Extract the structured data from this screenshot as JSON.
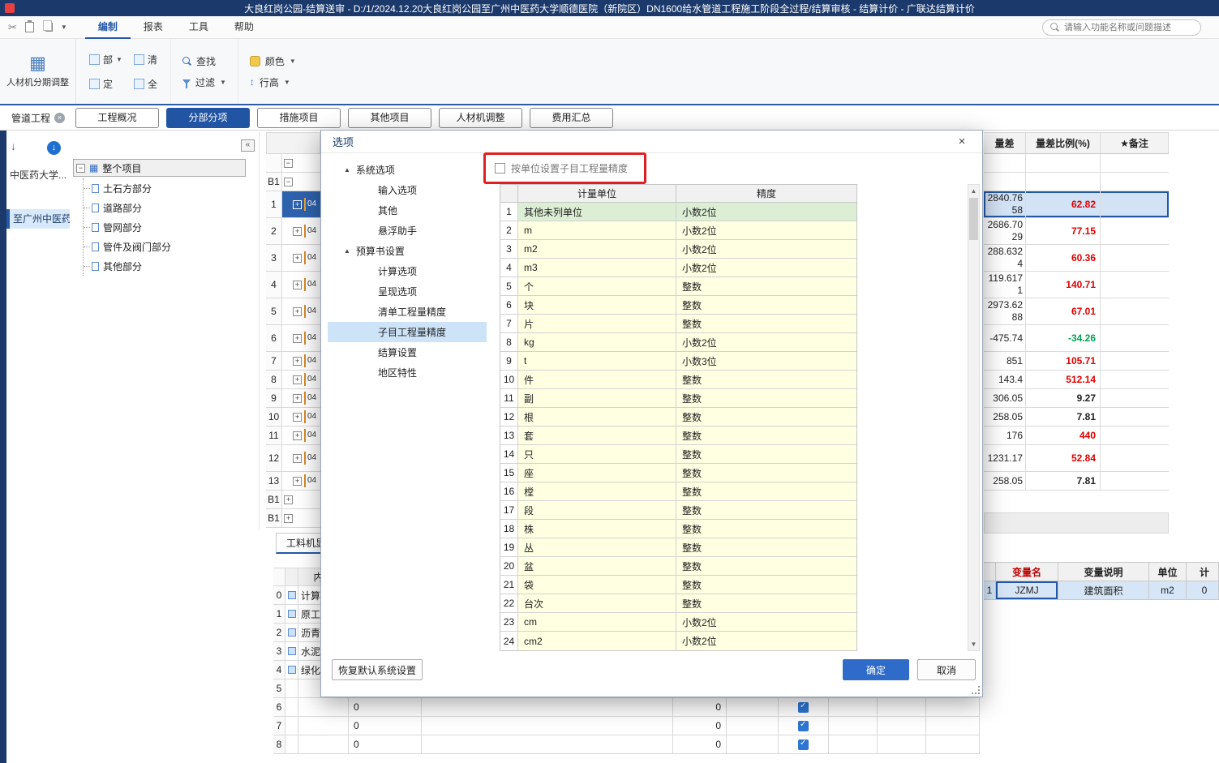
{
  "titlebar": {
    "title": "大良红岗公园-结算送审 - D:/1/2024.12.20大良红岗公园至广州中医药大学顺德医院（新院区）DN1600给水管道工程施工阶段全过程/结算审核 - 结算计价 - 广联达结算计价"
  },
  "menubar": {
    "items": [
      "编制",
      "报表",
      "工具",
      "帮助"
    ],
    "active": "编制",
    "search_placeholder": "请输入功能名称或问题描述"
  },
  "toolbar": {
    "period_adjust": "人材机分期调整",
    "compact_buttons": [
      "部",
      "清",
      "定",
      "全"
    ],
    "find": "查找",
    "filter": "过滤",
    "color": "颜色",
    "row_height": "行高"
  },
  "doc_tab": "管道工程",
  "view_tabs": [
    "工程概况",
    "分部分项",
    "措施项目",
    "其他项目",
    "人材机调整",
    "费用汇总"
  ],
  "active_view_tab": "分部分项",
  "project_list": [
    "中医药大学...",
    "至广州中医药..."
  ],
  "tree": {
    "root": "整个项目",
    "children": [
      "土石方部分",
      "道路部分",
      "管网部分",
      "管件及阀门部分",
      "其他部分"
    ]
  },
  "grid_rows": [
    "",
    "B1",
    "1",
    "2",
    "3",
    "4",
    "5",
    "6",
    "7",
    "8",
    "9",
    "10",
    "11",
    "12",
    "13",
    "B1",
    "B1"
  ],
  "grid_code_prefix": "04",
  "right_table": {
    "headers": [
      "量差",
      "量差比例(%)",
      "★备注"
    ],
    "rows": [
      {
        "diff": "",
        "ratio": "",
        "color": "black"
      },
      {
        "diff": "",
        "ratio": "",
        "color": "black"
      },
      {
        "diff": "2840.7658",
        "ratio": "62.82",
        "color": "red"
      },
      {
        "diff": "2686.7029",
        "ratio": "77.15",
        "color": "red"
      },
      {
        "diff": "288.6324",
        "ratio": "60.36",
        "color": "red"
      },
      {
        "diff": "119.6171",
        "ratio": "140.71",
        "color": "red"
      },
      {
        "diff": "2973.6288",
        "ratio": "67.01",
        "color": "red"
      },
      {
        "diff": "-475.74",
        "ratio": "-34.26",
        "color": "green"
      },
      {
        "diff": "851",
        "ratio": "105.71",
        "color": "red"
      },
      {
        "diff": "143.4",
        "ratio": "512.14",
        "color": "red"
      },
      {
        "diff": "306.05",
        "ratio": "9.27",
        "color": "black"
      },
      {
        "diff": "258.05",
        "ratio": "7.81",
        "color": "black"
      },
      {
        "diff": "176",
        "ratio": "440",
        "color": "red"
      },
      {
        "diff": "1231.17",
        "ratio": "52.84",
        "color": "red"
      },
      {
        "diff": "258.05",
        "ratio": "7.81",
        "color": "black"
      }
    ]
  },
  "dialog": {
    "title": "选项",
    "nav": [
      {
        "label": "系统选项",
        "group": true
      },
      {
        "label": "输入选项"
      },
      {
        "label": "其他"
      },
      {
        "label": "悬浮助手"
      },
      {
        "label": "预算书设置",
        "group": true
      },
      {
        "label": "计算选项"
      },
      {
        "label": "呈现选项"
      },
      {
        "label": "清单工程量精度"
      },
      {
        "label": "子目工程量精度",
        "selected": true
      },
      {
        "label": "结算设置"
      },
      {
        "label": "地区特性"
      }
    ],
    "checkbox_label": "按单位设置子目工程量精度",
    "checkbox_checked": false,
    "table": {
      "headers": [
        "计量单位",
        "精度"
      ],
      "rows": [
        {
          "unit": "其他未列单位",
          "precision": "小数2位"
        },
        {
          "unit": "m",
          "precision": "小数2位"
        },
        {
          "unit": "m2",
          "precision": "小数2位"
        },
        {
          "unit": "m3",
          "precision": "小数2位"
        },
        {
          "unit": "个",
          "precision": "整数"
        },
        {
          "unit": "块",
          "precision": "整数"
        },
        {
          "unit": "片",
          "precision": "整数"
        },
        {
          "unit": "kg",
          "precision": "小数2位"
        },
        {
          "unit": "t",
          "precision": "小数3位"
        },
        {
          "unit": "件",
          "precision": "整数"
        },
        {
          "unit": "副",
          "precision": "整数"
        },
        {
          "unit": "根",
          "precision": "整数"
        },
        {
          "unit": "套",
          "precision": "整数"
        },
        {
          "unit": "只",
          "precision": "整数"
        },
        {
          "unit": "座",
          "precision": "整数"
        },
        {
          "unit": "樘",
          "precision": "整数"
        },
        {
          "unit": "段",
          "precision": "整数"
        },
        {
          "unit": "株",
          "precision": "整数"
        },
        {
          "unit": "丛",
          "precision": "整数"
        },
        {
          "unit": "盆",
          "precision": "整数"
        },
        {
          "unit": "袋",
          "precision": "整数"
        },
        {
          "unit": "台次",
          "precision": "整数"
        },
        {
          "unit": "cm",
          "precision": "小数2位"
        },
        {
          "unit": "cm2",
          "precision": "小数2位"
        }
      ]
    },
    "buttons": {
      "restore": "恢复默认系统设置",
      "ok": "确定",
      "cancel": "取消"
    }
  },
  "bottom_panel": {
    "tab": "工料机显示",
    "header": "内容",
    "rows": [
      {
        "num": "0",
        "name": "计算"
      },
      {
        "num": "1",
        "name": "原工"
      },
      {
        "num": "2",
        "name": "沥青"
      },
      {
        "num": "3",
        "name": "水泥"
      },
      {
        "num": "4",
        "name": "绿化"
      },
      {
        "num": "5",
        "name": ""
      },
      {
        "num": "6",
        "name": "",
        "v1": "0",
        "v2": "0",
        "checked": true
      },
      {
        "num": "7",
        "name": "",
        "v1": "0",
        "v2": "0",
        "checked": true
      },
      {
        "num": "8",
        "name": "",
        "v1": "0",
        "v2": "0",
        "checked": true
      }
    ]
  },
  "vars_table": {
    "headers": [
      "变量名",
      "变量说明",
      "单位",
      "计"
    ],
    "row": {
      "num": "1",
      "name": "JZMJ",
      "desc": "建筑面积",
      "unit": "m2",
      "value": "0"
    }
  }
}
